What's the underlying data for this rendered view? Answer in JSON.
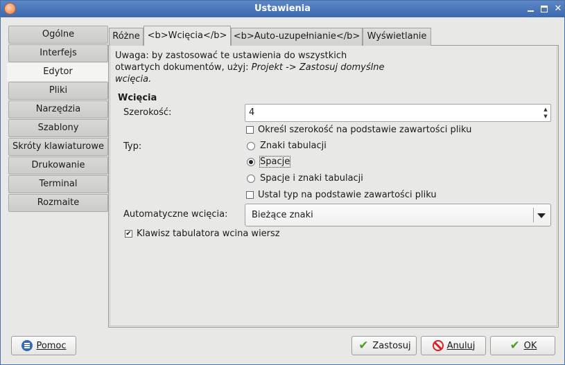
{
  "window": {
    "title": "Ustawienia"
  },
  "categories": [
    {
      "label": "Ogólne",
      "active": false
    },
    {
      "label": "Interfejs",
      "active": false
    },
    {
      "label": "Edytor",
      "active": true
    },
    {
      "label": "Pliki",
      "active": false
    },
    {
      "label": "Narzędzia",
      "active": false
    },
    {
      "label": "Szablony",
      "active": false
    },
    {
      "label": "Skróty klawiaturowe",
      "active": false
    },
    {
      "label": "Drukowanie",
      "active": false
    },
    {
      "label": "Terminal",
      "active": false
    },
    {
      "label": "Rozmaite",
      "active": false
    }
  ],
  "tabs": [
    {
      "label": "Różne"
    },
    {
      "label": "<b>Wcięcia</b>"
    },
    {
      "label": "<b>Auto-uzupełnianie</b>"
    },
    {
      "label": "Wyświetlanie"
    }
  ],
  "note": {
    "line1": "Uwaga: by zastosować te ustawienia do wszystkich",
    "line2_plain": "otwartych dokumentów, użyj: ",
    "line2_italic": "Projekt -> Zastosuj domyślne",
    "line3_italic": "wcięcia."
  },
  "indent": {
    "section_title": "Wcięcia",
    "width_label": "Szerokość:",
    "width_value": "4",
    "detect_width_label": "Określ szerokość na podstawie zawartości pliku",
    "detect_width_checked": false,
    "type_label": "Typ:",
    "type_options": [
      {
        "label": "Znaki tabulacji",
        "selected": false
      },
      {
        "label": "Spacje",
        "selected": true
      },
      {
        "label": "Spacje i znaki tabulacji",
        "selected": false
      }
    ],
    "detect_type_label": "Ustal typ na podstawie zawartości pliku",
    "detect_type_checked": false,
    "auto_indent_label": "Automatyczne wcięcia:",
    "auto_indent_value": "Bieżące znaki",
    "tab_indents_label": "Klawisz tabulatora wcina wiersz",
    "tab_indents_checked": true
  },
  "buttons": {
    "help": "Pomoc",
    "apply": "Zastosuj",
    "cancel": "Anuluj",
    "ok": "OK"
  },
  "colors": {
    "titlebar": "#3c6aae",
    "ok_check": "#4d9e1b",
    "cancel_red": "#d92020",
    "help_blue": "#3468b8"
  }
}
